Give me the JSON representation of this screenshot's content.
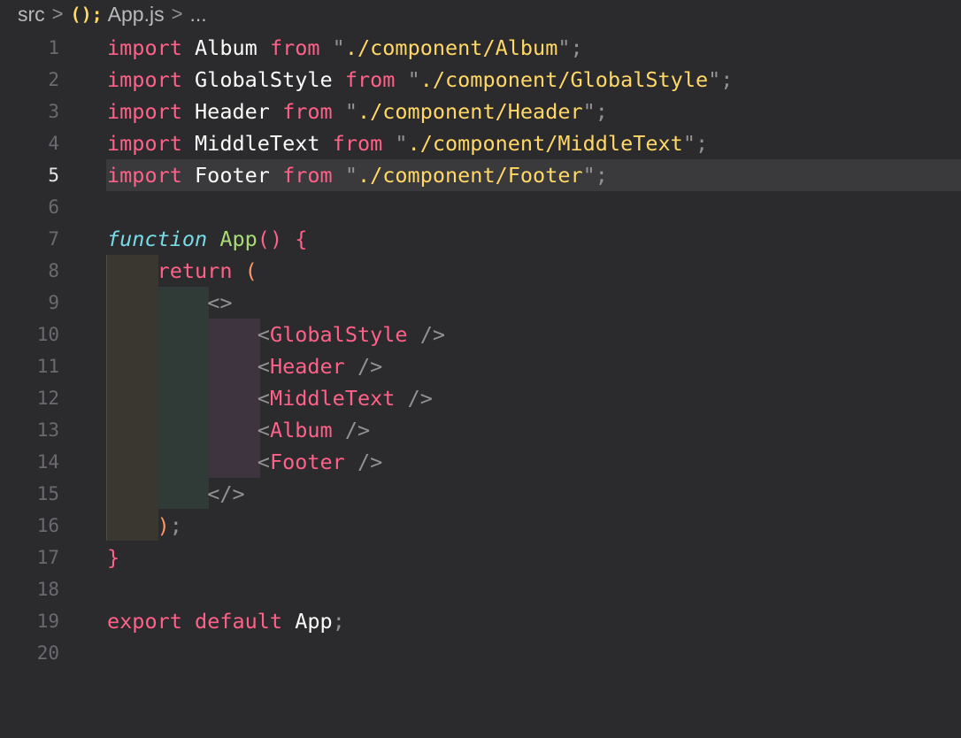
{
  "breadcrumb": {
    "root": "src",
    "separator": ">",
    "file_icon": "js-file-icon",
    "file_icon_glyph": "();",
    "file": "App.js",
    "more": "..."
  },
  "editor": {
    "current_line": 5,
    "lines": [
      {
        "n": "1",
        "tokens": [
          {
            "t": "import",
            "c": "kw"
          },
          {
            "t": " Album ",
            "c": "ident"
          },
          {
            "t": "from",
            "c": "kw"
          },
          {
            "t": " \"",
            "c": "quote"
          },
          {
            "t": "./component/Album",
            "c": "str"
          },
          {
            "t": "\";",
            "c": "quote"
          }
        ]
      },
      {
        "n": "2",
        "tokens": [
          {
            "t": "import",
            "c": "kw"
          },
          {
            "t": " GlobalStyle ",
            "c": "ident"
          },
          {
            "t": "from",
            "c": "kw"
          },
          {
            "t": " \"",
            "c": "quote"
          },
          {
            "t": "./component/GlobalStyle",
            "c": "str"
          },
          {
            "t": "\";",
            "c": "quote"
          }
        ]
      },
      {
        "n": "3",
        "tokens": [
          {
            "t": "import",
            "c": "kw"
          },
          {
            "t": " Header ",
            "c": "ident"
          },
          {
            "t": "from",
            "c": "kw"
          },
          {
            "t": " \"",
            "c": "quote"
          },
          {
            "t": "./component/Header",
            "c": "str"
          },
          {
            "t": "\";",
            "c": "quote"
          }
        ]
      },
      {
        "n": "4",
        "tokens": [
          {
            "t": "import",
            "c": "kw"
          },
          {
            "t": " MiddleText ",
            "c": "ident"
          },
          {
            "t": "from",
            "c": "kw"
          },
          {
            "t": " \"",
            "c": "quote"
          },
          {
            "t": "./component/MiddleText",
            "c": "str"
          },
          {
            "t": "\";",
            "c": "quote"
          }
        ]
      },
      {
        "n": "5",
        "tokens": [
          {
            "t": "import",
            "c": "kw"
          },
          {
            "t": " Footer ",
            "c": "ident"
          },
          {
            "t": "from",
            "c": "kw"
          },
          {
            "t": " \"",
            "c": "quote"
          },
          {
            "t": "./component/Footer",
            "c": "str"
          },
          {
            "t": "\";",
            "c": "quote"
          }
        ]
      },
      {
        "n": "6",
        "tokens": []
      },
      {
        "n": "7",
        "tokens": [
          {
            "t": "function",
            "c": "storage"
          },
          {
            "t": " ",
            "c": "ident"
          },
          {
            "t": "App",
            "c": "fn"
          },
          {
            "t": "() {",
            "c": "kw"
          }
        ]
      },
      {
        "n": "8",
        "tokens": [
          {
            "t": "    ",
            "c": "ident"
          },
          {
            "t": "return",
            "c": "kw"
          },
          {
            "t": " (",
            "c": "paren"
          }
        ]
      },
      {
        "n": "9",
        "tokens": [
          {
            "t": "        ",
            "c": "ident"
          },
          {
            "t": "<>",
            "c": "punc"
          }
        ]
      },
      {
        "n": "10",
        "tokens": [
          {
            "t": "            ",
            "c": "ident"
          },
          {
            "t": "<",
            "c": "punc"
          },
          {
            "t": "GlobalStyle",
            "c": "tag"
          },
          {
            "t": " />",
            "c": "punc"
          }
        ]
      },
      {
        "n": "11",
        "tokens": [
          {
            "t": "            ",
            "c": "ident"
          },
          {
            "t": "<",
            "c": "punc"
          },
          {
            "t": "Header",
            "c": "tag"
          },
          {
            "t": " />",
            "c": "punc"
          }
        ]
      },
      {
        "n": "12",
        "tokens": [
          {
            "t": "            ",
            "c": "ident"
          },
          {
            "t": "<",
            "c": "punc"
          },
          {
            "t": "MiddleText",
            "c": "tag"
          },
          {
            "t": " />",
            "c": "punc"
          }
        ]
      },
      {
        "n": "13",
        "tokens": [
          {
            "t": "            ",
            "c": "ident"
          },
          {
            "t": "<",
            "c": "punc"
          },
          {
            "t": "Album",
            "c": "tag"
          },
          {
            "t": " />",
            "c": "punc"
          }
        ]
      },
      {
        "n": "14",
        "tokens": [
          {
            "t": "            ",
            "c": "ident"
          },
          {
            "t": "<",
            "c": "punc"
          },
          {
            "t": "Footer",
            "c": "tag"
          },
          {
            "t": " />",
            "c": "punc"
          }
        ]
      },
      {
        "n": "15",
        "tokens": [
          {
            "t": "        ",
            "c": "ident"
          },
          {
            "t": "</>",
            "c": "punc"
          }
        ]
      },
      {
        "n": "16",
        "tokens": [
          {
            "t": "    ",
            "c": "ident"
          },
          {
            "t": ")",
            "c": "paren"
          },
          {
            "t": ";",
            "c": "punc"
          }
        ]
      },
      {
        "n": "17",
        "tokens": [
          {
            "t": "}",
            "c": "kw"
          }
        ]
      },
      {
        "n": "18",
        "tokens": []
      },
      {
        "n": "19",
        "tokens": [
          {
            "t": "export",
            "c": "kw"
          },
          {
            "t": " ",
            "c": "ident"
          },
          {
            "t": "default",
            "c": "kw"
          },
          {
            "t": " App",
            "c": "ident"
          },
          {
            "t": ";",
            "c": "punc"
          }
        ]
      },
      {
        "n": "20",
        "tokens": []
      }
    ]
  },
  "colors": {
    "background": "#2b2a2d",
    "keyword": "#ff6188",
    "string": "#ffd866",
    "function": "#a9dc76",
    "storage": "#78dce8",
    "paren": "#fc9867",
    "punctuation": "#939293"
  }
}
